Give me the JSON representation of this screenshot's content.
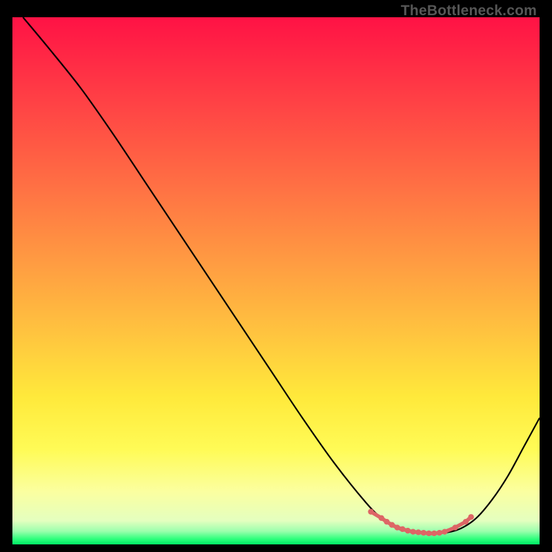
{
  "watermark": "TheBottleneck.com",
  "chart_data": {
    "type": "line",
    "title": "",
    "xlabel": "",
    "ylabel": "",
    "xlim": [
      0,
      100
    ],
    "ylim": [
      0,
      100
    ],
    "grid": false,
    "series": [
      {
        "name": "curve",
        "color": "#000000",
        "x": [
          2,
          7,
          13,
          19,
          25,
          31,
          37,
          43,
          49,
          55,
          61,
          67,
          70,
          73,
          76,
          79,
          82,
          85,
          88,
          91,
          94,
          97,
          100
        ],
        "y": [
          100,
          94,
          86.5,
          78,
          69,
          60,
          51,
          42,
          33,
          24,
          15.5,
          8,
          5,
          3,
          2.3,
          2,
          2.2,
          3,
          5,
          8.5,
          13,
          18.5,
          24
        ]
      },
      {
        "name": "highlight",
        "color": "#dd6666",
        "marker": "circle",
        "x": [
          68,
          70,
          71,
          72,
          73,
          74,
          75,
          76,
          77,
          78,
          79,
          80,
          81,
          82,
          84,
          86,
          87
        ],
        "y": [
          6.2,
          5,
          4.3,
          3.7,
          3.2,
          2.9,
          2.6,
          2.4,
          2.3,
          2.2,
          2.1,
          2.1,
          2.2,
          2.4,
          3.2,
          4.3,
          5.2
        ]
      }
    ],
    "background_gradient": {
      "stops": [
        {
          "offset": 0.0,
          "color": "#ff1245"
        },
        {
          "offset": 0.15,
          "color": "#ff3e45"
        },
        {
          "offset": 0.3,
          "color": "#ff6a44"
        },
        {
          "offset": 0.45,
          "color": "#ff9742"
        },
        {
          "offset": 0.6,
          "color": "#ffc43f"
        },
        {
          "offset": 0.72,
          "color": "#ffe93b"
        },
        {
          "offset": 0.82,
          "color": "#fffb56"
        },
        {
          "offset": 0.9,
          "color": "#fbffa0"
        },
        {
          "offset": 0.955,
          "color": "#e4ffbf"
        },
        {
          "offset": 0.975,
          "color": "#9bffad"
        },
        {
          "offset": 0.99,
          "color": "#2cff7b"
        },
        {
          "offset": 1.0,
          "color": "#00e865"
        }
      ]
    }
  }
}
